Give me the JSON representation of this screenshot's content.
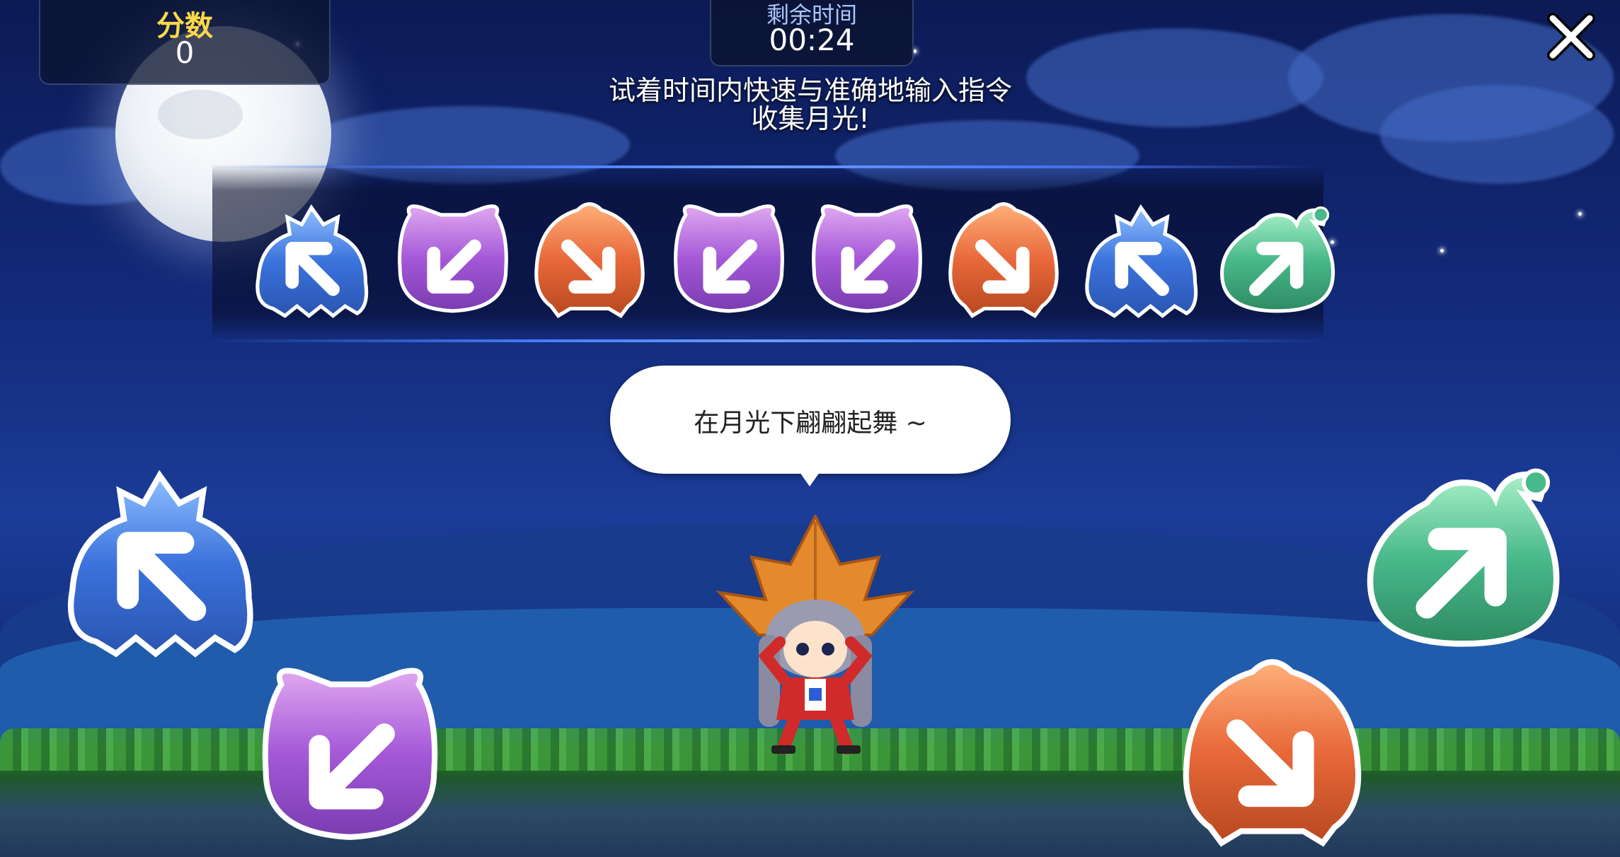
{
  "hud": {
    "score_label": "分数",
    "score_value": "0",
    "timer_label": "剩余时间",
    "timer_value": "00:24"
  },
  "instructions": {
    "line1": "试着时间内快速与准确地输入指令",
    "line2": "收集月光!"
  },
  "command_sequence": [
    {
      "direction": "up-left",
      "color": "blue",
      "icon": "arrow-up-left-icon"
    },
    {
      "direction": "down-left",
      "color": "purple",
      "icon": "arrow-down-left-icon"
    },
    {
      "direction": "down-right",
      "color": "orange",
      "icon": "arrow-down-right-icon"
    },
    {
      "direction": "down-left",
      "color": "purple",
      "icon": "arrow-down-left-icon"
    },
    {
      "direction": "down-left",
      "color": "purple",
      "icon": "arrow-down-left-icon"
    },
    {
      "direction": "down-right",
      "color": "orange",
      "icon": "arrow-down-right-icon"
    },
    {
      "direction": "up-left",
      "color": "blue",
      "icon": "arrow-up-left-icon"
    },
    {
      "direction": "up-right",
      "color": "green",
      "icon": "arrow-up-right-icon"
    }
  ],
  "controls": [
    {
      "direction": "up-left",
      "color": "blue"
    },
    {
      "direction": "down-left",
      "color": "purple"
    },
    {
      "direction": "up-right",
      "color": "green"
    },
    {
      "direction": "down-right",
      "color": "orange"
    }
  ],
  "speech_bubble": "在月光下翩翩起舞 ~",
  "colors": {
    "blue": "#4a86e8",
    "purple": "#a45ad8",
    "orange": "#e8683a",
    "green": "#48b98a",
    "score_label": "#ffd84a"
  }
}
